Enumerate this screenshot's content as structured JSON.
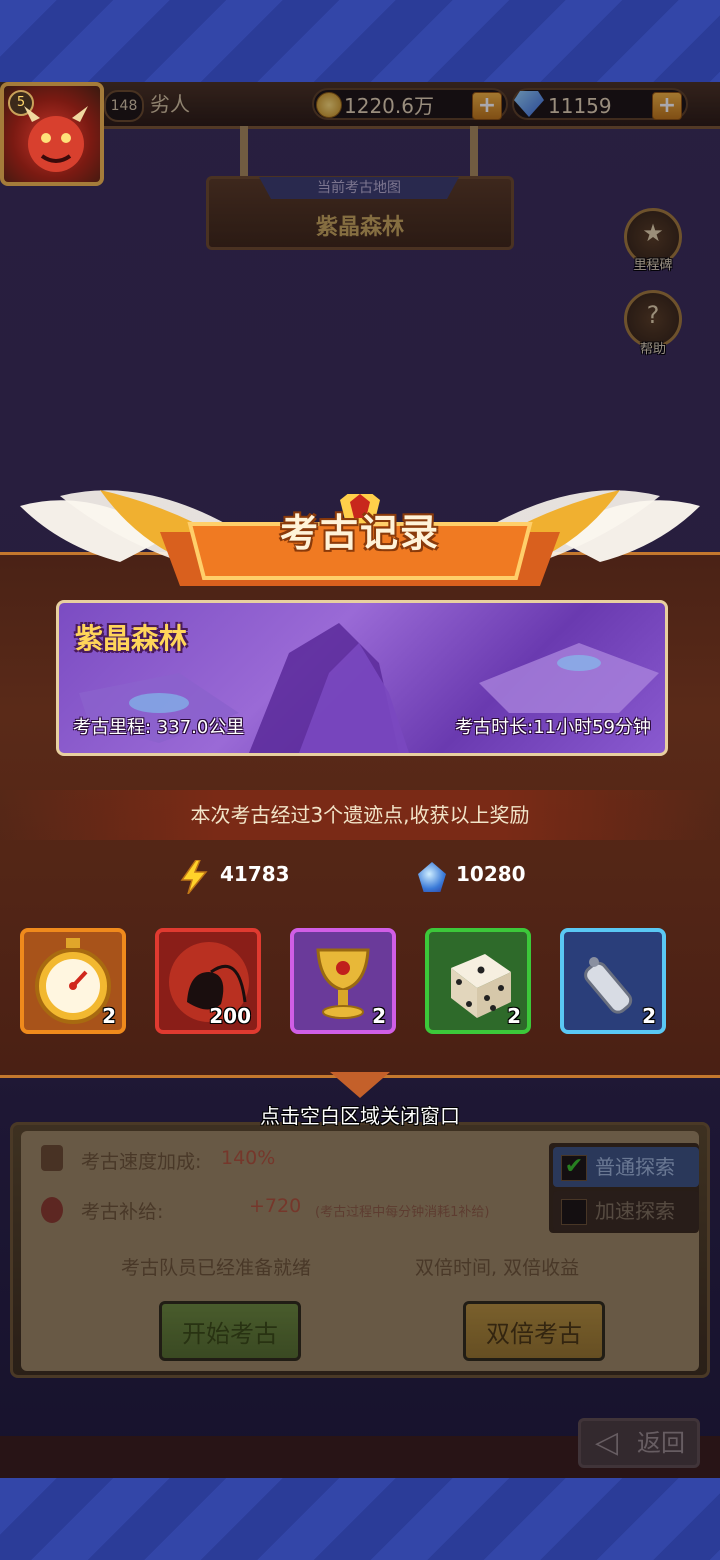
{
  "player": {
    "level_badge": "5",
    "level": "148",
    "name": "劣人"
  },
  "resources": {
    "gold": "1220.6万",
    "gems": "11159",
    "plus": "+"
  },
  "map_sign": {
    "caption": "当前考古地图",
    "name": "紫晶森林"
  },
  "side_buttons": {
    "milestone": "里程碑",
    "help": "帮助"
  },
  "record": {
    "title": "考古记录",
    "map_name": "紫晶森林",
    "distance": "考古里程: 337.0公里",
    "duration": "考古时长:11小时59分钟",
    "summary": "本次考古经过3个遗迹点,收获以上奖励",
    "energy": "41783",
    "crystals": "10280",
    "items": [
      {
        "name": "stopwatch",
        "count": "2",
        "border": "#f08a1c",
        "bg": "#a8531a"
      },
      {
        "name": "pouch",
        "count": "200",
        "border": "#e03a30",
        "bg": "#8a1e18"
      },
      {
        "name": "goblet",
        "count": "2",
        "border": "#d05ee6",
        "bg": "#6a3a9a"
      },
      {
        "name": "dice",
        "count": "2",
        "border": "#3cc83a",
        "bg": "#2e6a2a"
      },
      {
        "name": "whistle",
        "count": "2",
        "border": "#5ac8f4",
        "bg": "#2a3e7a"
      }
    ],
    "close_hint": "点击空白区域关闭窗口"
  },
  "panel": {
    "speed_label": "考古速度加成:",
    "speed_value": "140%",
    "supply_label": "考古补给:",
    "supply_value": "+720",
    "supply_note": "(考古过程中每分钟消耗1补给)",
    "mode_normal": "普通探索",
    "mode_fast": "加速探索",
    "ready_text": "考古队员已经准备就绪",
    "double_text": "双倍时间, 双倍收益",
    "start_button": "开始考古",
    "double_button": "双倍考古"
  },
  "back_button": "返回"
}
